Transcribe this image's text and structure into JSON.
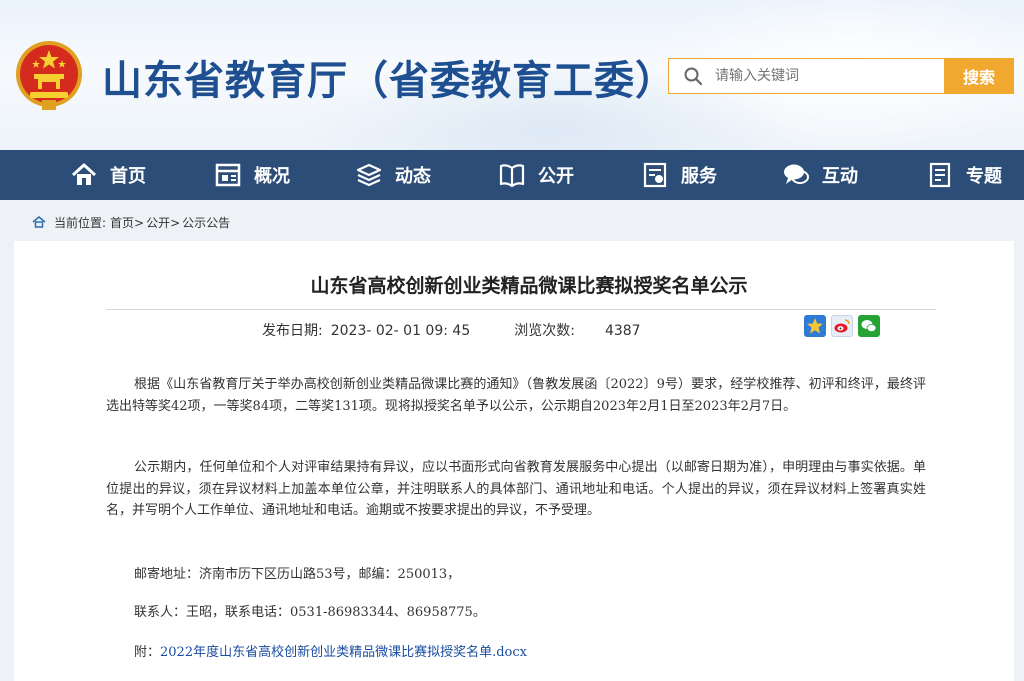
{
  "header": {
    "title": "山东省教育厅（省委教育工委）",
    "search_placeholder": "请输入关键词",
    "search_button": "搜索"
  },
  "nav": [
    {
      "label": "首页",
      "icon": "home-icon"
    },
    {
      "label": "概况",
      "icon": "overview-icon"
    },
    {
      "label": "动态",
      "icon": "news-icon"
    },
    {
      "label": "公开",
      "icon": "book-icon"
    },
    {
      "label": "服务",
      "icon": "service-icon"
    },
    {
      "label": "互动",
      "icon": "chat-icon"
    },
    {
      "label": "专题",
      "icon": "topic-icon"
    }
  ],
  "breadcrumb": {
    "prefix": "当前位置:",
    "items": [
      "首页>",
      "公开>",
      "公示公告"
    ]
  },
  "article": {
    "title": "山东省高校创新创业类精品微课比赛拟授奖名单公示",
    "publish_label": "发布日期:",
    "publish_date": "2023- 02- 01 09: 45",
    "views_label": "浏览次数:",
    "views": "4387",
    "share_icons": [
      "qzone-icon",
      "weibo-icon",
      "wechat-icon"
    ],
    "paragraphs": [
      "根据《山东省教育厅关于举办高校创新创业类精品微课比赛的通知》（鲁教发展函〔2022〕9号）要求，经学校推荐、初评和终评，最终评选出特等奖42项，一等奖84项，二等奖131项。现将拟授奖名单予以公示，公示期自2023年2月1日至2023年2月7日。",
      "公示期内，任何单位和个人对评审结果持有异议，应以书面形式向省教育发展服务中心提出（以邮寄日期为准），申明理由与事实依据。单位提出的异议，须在异议材料上加盖本单位公章，并注明联系人的具体部门、通讯地址和电话。个人提出的异议，须在异议材料上签署真实姓名，并写明个人工作单位、通讯地址和电话。逾期或不按要求提出的异议，不予受理。"
    ],
    "address": "邮寄地址：济南市历下区历山路53号，邮编：250013，",
    "contact": "联系人：王昭，联系电话：0531-86983344、86958775。",
    "attachment_label": "附：",
    "attachment_link": "2022年度山东省高校创新创业类精品微课比赛拟授奖名单.docx"
  },
  "colors": {
    "title_blue": "#1d4f91",
    "nav_bg": "#2b4d78",
    "search_accent": "#f0a830",
    "link": "#1a4da1"
  }
}
